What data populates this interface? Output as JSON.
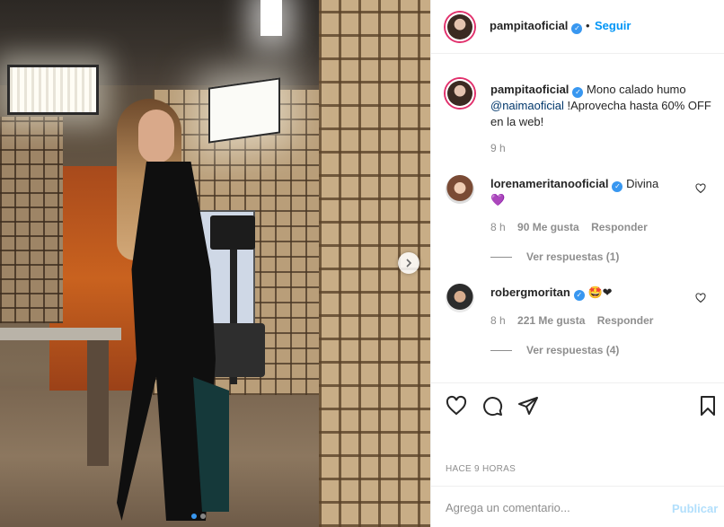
{
  "post": {
    "author": "pampitaoficial",
    "follow_separator": "•",
    "follow_label": "Seguir",
    "caption_start": "Mono calado humo ",
    "caption_mention": "@naimaoficial",
    "caption_end": " !Aprovecha hasta 60% OFF en la web!",
    "caption_time": "9 h"
  },
  "comments": [
    {
      "username": "lorenameritanooficial",
      "text": "Divina",
      "emoji": "💜",
      "time": "8 h",
      "likes": "90 Me gusta",
      "reply_label": "Responder",
      "view_replies": "Ver respuestas (1)"
    },
    {
      "username": "robergmoritan",
      "text": "",
      "emoji": "🤩❤",
      "time": "8 h",
      "likes": "221 Me gusta",
      "reply_label": "Responder",
      "view_replies": "Ver respuestas (4)"
    }
  ],
  "actions": {
    "like_icon": "heart-icon",
    "comment_icon": "comment-icon",
    "share_icon": "send-icon",
    "save_icon": "bookmark-icon",
    "time_ago": "HACE 9 HORAS"
  },
  "compose": {
    "placeholder": "Agrega un comentario...",
    "publish_label": "Publicar"
  },
  "carousel": {
    "next_icon": "chevron-right-icon",
    "slide_count": 2,
    "active_slide": 1
  },
  "colors": {
    "accent": "#0095f6",
    "verified": "#3897f0",
    "muted": "#8e8e8e",
    "text": "#262626",
    "publish_disabled": "#b2dffc"
  }
}
